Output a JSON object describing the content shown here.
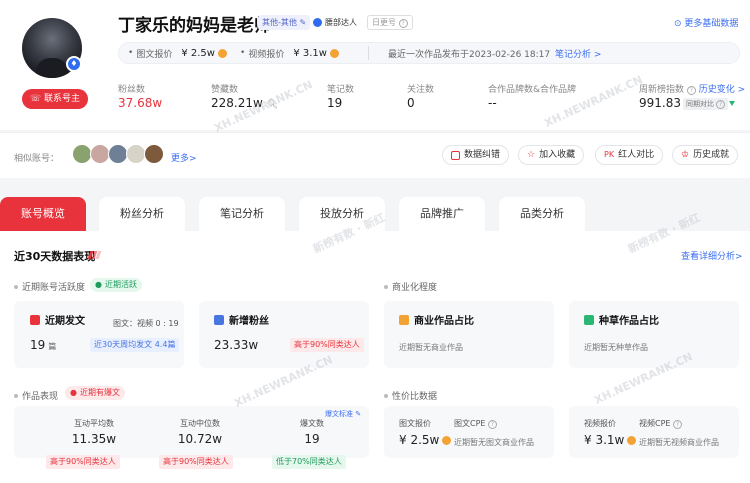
{
  "profile": {
    "name": "丁家乐的妈妈是老师",
    "category_tag": "其他-其他",
    "level_tag": "腰部达人",
    "daily_tag": "日更号",
    "contact_label": "联系号主",
    "more_info_label": "更多基础数据"
  },
  "price_bar": {
    "image_label": "图文报价",
    "image_value": "¥ 2.5w",
    "video_label": "视频报价",
    "video_value": "¥ 3.1w",
    "latest_post": "最近一次作品发布于2023-02-26 18:17",
    "analysis_link": "笔记分析 >"
  },
  "stats": [
    {
      "label": "粉丝数",
      "value": "37.68w"
    },
    {
      "label": "赞藏数",
      "value": "228.21w"
    },
    {
      "label": "笔记数",
      "value": "19"
    },
    {
      "label": "关注数",
      "value": "0"
    },
    {
      "label": "合作品牌数&合作品牌",
      "value": "--"
    },
    {
      "label": "周新榜指数",
      "value": "991.83"
    }
  ],
  "index_extra": {
    "history_link": "历史变化 >",
    "compare_label": "同期对比"
  },
  "similar": {
    "label": "相似账号：",
    "more_label": "更多>",
    "avatar_colors": [
      "#8aa26d",
      "#c9a7a0",
      "#6f7f95",
      "#d8d3c8",
      "#7e5a3c"
    ]
  },
  "actions": [
    {
      "label": "数据纠错",
      "icon": "edit-icon"
    },
    {
      "label": "加入收藏",
      "icon": "star-icon"
    },
    {
      "label": "红人对比",
      "icon": "compare-icon"
    },
    {
      "label": "历史成就",
      "icon": "trophy-icon"
    }
  ],
  "tabs": [
    "账号概览",
    "粉丝分析",
    "笔记分析",
    "投放分析",
    "品牌推广",
    "品类分析"
  ],
  "overview": {
    "title": "近30天数据表现",
    "detail_link": "查看详细分析>",
    "activity_label": "近期账号活跃度",
    "activity_pill": "近期活跃",
    "commercial_label": "商业化程度",
    "works_label": "作品表现",
    "works_pill": "近期有爆文",
    "value_label": "性价比数据"
  },
  "cards": {
    "recent_post": {
      "title": "近期发文",
      "ratio": "图文：视频 0 : 19",
      "value": "19",
      "unit": "篇",
      "chip": "近30天周均发文 4.4篇"
    },
    "new_fans": {
      "title": "新增粉丝",
      "value": "23.33w",
      "chip": "高于90%同类达人"
    },
    "commercial": {
      "title": "商业作品占比",
      "note": "近期暂无商业作品"
    },
    "seeding": {
      "title": "种草作品占比",
      "note": "近期暂无种草作品"
    },
    "works": {
      "standard_link": "爆文标准",
      "items": [
        {
          "label": "互动平均数",
          "value": "11.35w",
          "chip": "高于90%同类达人",
          "chip_type": "red"
        },
        {
          "label": "互动中位数",
          "value": "10.72w",
          "chip": "高于90%同类达人",
          "chip_type": "red"
        },
        {
          "label": "爆文数",
          "value": "19",
          "chip": "低于70%同类达人",
          "chip_type": "green"
        }
      ]
    },
    "value_image": {
      "price_label": "图文报价",
      "price_value": "¥ 2.5w",
      "cpe_label": "图文CPE",
      "cpe_note": "近期暂无图文商业作品"
    },
    "value_video": {
      "price_label": "视频报价",
      "price_value": "¥ 3.1w",
      "cpe_label": "视频CPE",
      "cpe_note": "近期暂无视频商业作品"
    }
  },
  "watermarks": [
    "XH.NEWRANK.CN",
    "新榜有数 · 新红"
  ],
  "colors": {
    "brand_red": "#e8323c",
    "link_blue": "#3b6ef0",
    "green": "#1d9b5a"
  }
}
